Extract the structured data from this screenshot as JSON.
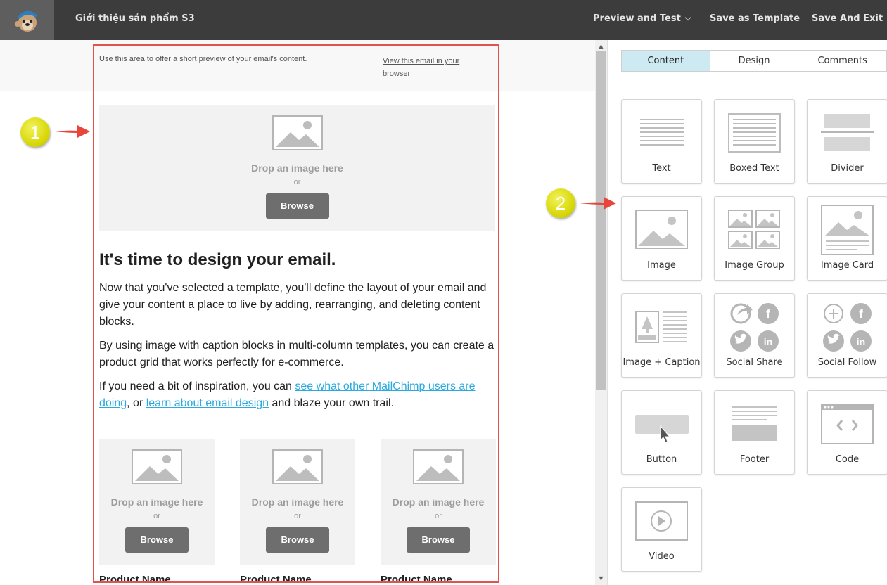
{
  "header": {
    "campaign_title": "Giới thiệu sản phẩm S3",
    "preview_label": "Preview and Test",
    "save_template_label": "Save as Template",
    "save_exit_label": "Save And Exit"
  },
  "email": {
    "preheader_text": "Use this area to offer a short preview of your email's content.",
    "view_in_browser": "View this email in your browser",
    "hero_drop_text": "Drop an image here",
    "or_text": "or",
    "browse_label": "Browse",
    "heading": "It's time to design your email.",
    "paragraph1": "Now that you've selected a template, you'll define the layout of your email and give your content a place to live by adding, rearranging, and deleting content blocks.",
    "paragraph2": "By using image with caption blocks in multi-column templates, you can create a product grid that works perfectly for e-commerce.",
    "p3_start": "If you need a bit of inspiration, you can ",
    "p3_link1": "see what other MailChimp users are doing",
    "p3_mid": ", or ",
    "p3_link2": "learn about email design",
    "p3_end": " and blaze your own trail.",
    "products": [
      {
        "drop_text": "Drop an image here",
        "or_text": "or",
        "browse_label": "Browse",
        "name": "Product Name"
      },
      {
        "drop_text": "Drop an image here",
        "or_text": "or",
        "browse_label": "Browse",
        "name": "Product Name"
      },
      {
        "drop_text": "Drop an image here",
        "or_text": "or",
        "browse_label": "Browse",
        "name": "Product Name"
      }
    ]
  },
  "panel": {
    "tabs": [
      {
        "label": "Content",
        "active": true
      },
      {
        "label": "Design",
        "active": false
      },
      {
        "label": "Comments",
        "active": false
      }
    ],
    "blocks": [
      {
        "label": "Text",
        "icon": "text-block-icon"
      },
      {
        "label": "Boxed Text",
        "icon": "boxed-text-block-icon"
      },
      {
        "label": "Divider",
        "icon": "divider-block-icon"
      },
      {
        "label": "Image",
        "icon": "image-block-icon"
      },
      {
        "label": "Image Group",
        "icon": "image-group-block-icon"
      },
      {
        "label": "Image Card",
        "icon": "image-card-block-icon"
      },
      {
        "label": "Image + Caption",
        "icon": "image-caption-block-icon"
      },
      {
        "label": "Social Share",
        "icon": "social-share-block-icon"
      },
      {
        "label": "Social Follow",
        "icon": "social-follow-block-icon"
      },
      {
        "label": "Button",
        "icon": "button-block-icon"
      },
      {
        "label": "Footer",
        "icon": "footer-block-icon"
      },
      {
        "label": "Code",
        "icon": "code-block-icon"
      },
      {
        "label": "Video",
        "icon": "video-block-icon"
      }
    ]
  },
  "annotations": {
    "marker1": "1",
    "marker2": "2"
  },
  "colors": {
    "topbar": "#3c3c3c",
    "highlight_border": "#e2534d",
    "link": "#2baadf",
    "active_tab": "#cdeaf3",
    "marker": "#d4d400"
  }
}
